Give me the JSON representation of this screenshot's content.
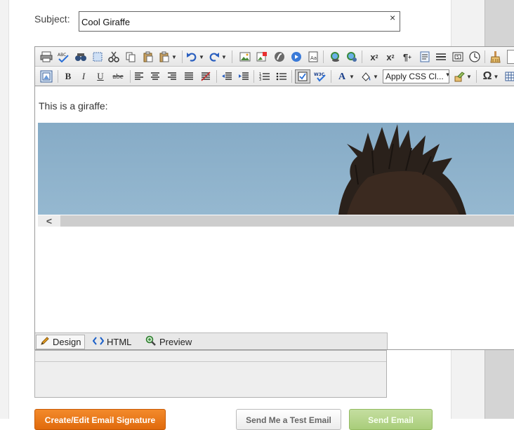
{
  "subject": {
    "label": "Subject:",
    "value": "Cool Giraffe",
    "clear_label": "×"
  },
  "toolbar": {
    "row1": [
      {
        "icon": "print-icon",
        "glyph": "🖶"
      },
      {
        "icon": "spellcheck-icon",
        "glyph": "✓"
      },
      {
        "icon": "find-replace-icon",
        "glyph": "🔭"
      },
      {
        "icon": "select-all-icon",
        "glyph": "⬚"
      },
      {
        "icon": "cut-icon",
        "glyph": "✂"
      },
      {
        "icon": "copy-icon",
        "glyph": "⎘"
      },
      {
        "icon": "paste-icon",
        "glyph": "📋"
      },
      {
        "icon": "paste-options-icon",
        "glyph": "📋"
      },
      {
        "icon": "undo-icon",
        "glyph": "↶"
      },
      {
        "icon": "redo-icon",
        "glyph": "↷"
      },
      {
        "icon": "image-manager-icon",
        "glyph": "🖼"
      },
      {
        "icon": "image-map-icon",
        "glyph": "🖻"
      },
      {
        "icon": "flash-icon",
        "glyph": "◉"
      },
      {
        "icon": "media-icon",
        "glyph": "▶"
      },
      {
        "icon": "document-manager-icon",
        "glyph": "🗎"
      },
      {
        "icon": "hyperlink-icon",
        "glyph": "🔗"
      },
      {
        "icon": "remove-link-icon",
        "glyph": "⛓"
      },
      {
        "icon": "superscript-icon",
        "glyph": "x²"
      },
      {
        "icon": "subscript-icon",
        "glyph": "x₂"
      },
      {
        "icon": "paragraph-icon",
        "glyph": "¶"
      },
      {
        "icon": "template-icon",
        "glyph": "▤"
      },
      {
        "icon": "horizontal-rule-icon",
        "glyph": "☰"
      },
      {
        "icon": "form-element-icon",
        "glyph": "▣"
      },
      {
        "icon": "insert-date-icon",
        "glyph": "🕓"
      },
      {
        "icon": "format-stripper-icon",
        "glyph": "🧹"
      }
    ],
    "row2": [
      {
        "icon": "table-properties-icon",
        "glyph": "▦"
      },
      {
        "icon": "bold-icon",
        "glyph": "B"
      },
      {
        "icon": "italic-icon",
        "glyph": "I"
      },
      {
        "icon": "underline-icon",
        "glyph": "U"
      },
      {
        "icon": "strikethrough-icon",
        "glyph": "abe"
      },
      {
        "icon": "align-left-icon",
        "glyph": "☰"
      },
      {
        "icon": "align-center-icon",
        "glyph": "☰"
      },
      {
        "icon": "align-right-icon",
        "glyph": "☰"
      },
      {
        "icon": "justify-icon",
        "glyph": "☰"
      },
      {
        "icon": "remove-alignment-icon",
        "glyph": "▤"
      },
      {
        "icon": "outdent-icon",
        "glyph": "⇤"
      },
      {
        "icon": "indent-icon",
        "glyph": "⇥"
      },
      {
        "icon": "numbered-list-icon",
        "glyph": "⒈"
      },
      {
        "icon": "bulleted-list-icon",
        "glyph": "•"
      },
      {
        "icon": "toggle-borders-icon",
        "glyph": "◫"
      },
      {
        "icon": "xhtml-validator-icon",
        "glyph": "W3C"
      },
      {
        "icon": "font-color-icon",
        "glyph": "A"
      },
      {
        "icon": "background-color-icon",
        "glyph": "⛶"
      },
      {
        "icon": "css-class-select",
        "glyph": ""
      },
      {
        "icon": "format-painter-icon",
        "glyph": "✎"
      },
      {
        "icon": "special-characters-icon",
        "glyph": "Ω"
      },
      {
        "icon": "insert-table-icon",
        "glyph": "▦"
      }
    ],
    "css_select_label": "Apply CSS Cl..."
  },
  "content": {
    "text": "This is a giraffe:"
  },
  "scroll": {
    "left_arrow": "<"
  },
  "modes": {
    "design": "Design",
    "html": "HTML",
    "preview": "Preview",
    "active": "design"
  },
  "buttons": {
    "signature": "Create/Edit Email Signature",
    "test_email": "Send Me a Test Email",
    "send_email": "Send Email"
  },
  "colors": {
    "sky": "#8fb3cc",
    "orange": "#e86f10",
    "green": "#a9cd7a",
    "hair": "#2a211b"
  }
}
